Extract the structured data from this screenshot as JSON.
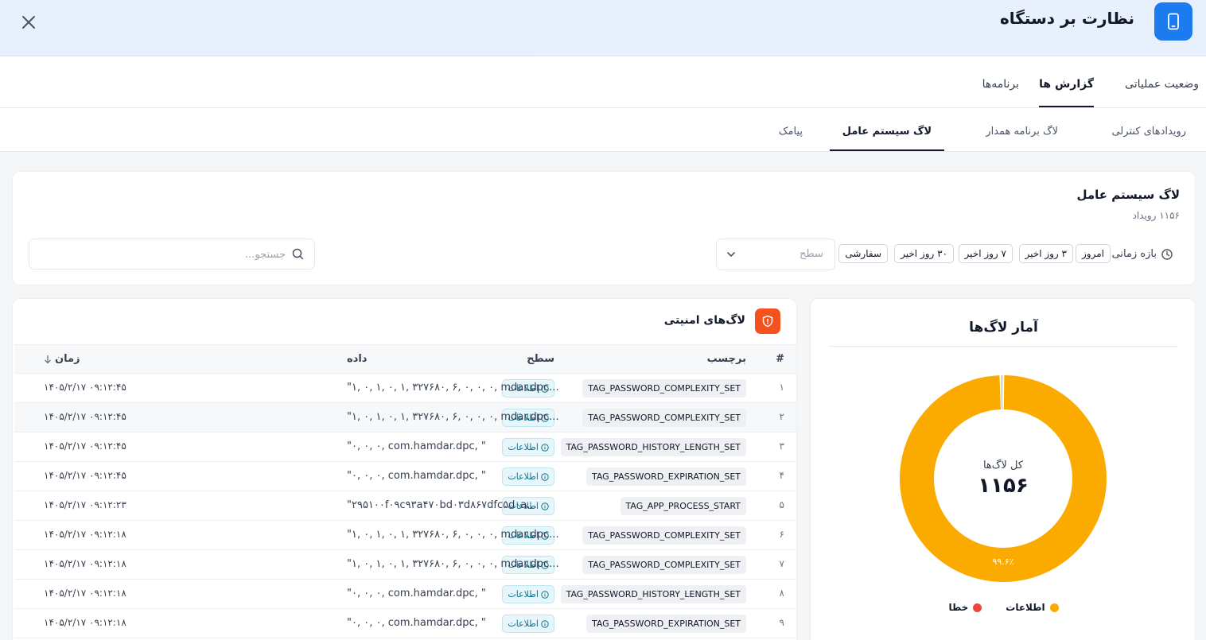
{
  "header": {
    "title": "نظارت بر دستگاه",
    "app_icon": "phone-icon",
    "close_icon": "close-icon"
  },
  "tabs": [
    {
      "label": "وضعیت عملیاتی",
      "active": false
    },
    {
      "label": "گزارش ها",
      "active": true
    },
    {
      "label": "برنامه‌ها",
      "active": false
    }
  ],
  "subtabs": [
    {
      "label": "رویدادهای کنترلی",
      "active": false
    },
    {
      "label": "لاگ برنامه همدار",
      "active": false
    },
    {
      "label": "لاگ سیستم عامل",
      "active": true
    },
    {
      "label": "پیامک",
      "active": false
    }
  ],
  "filters": {
    "title": "لاگ سیستم عامل",
    "count_text": "۱۱۵۶ رویداد",
    "range_label": "بازه زمانی:",
    "chips": [
      "امروز",
      "۳ روز اخیر",
      "۷ روز اخیر",
      "۳۰ روز اخیر",
      "سفارشی"
    ],
    "level_placeholder": "سطح",
    "search_placeholder": "جستجو..."
  },
  "table": {
    "title": "لاگ‌های امنیتی",
    "columns": {
      "num": "#",
      "tag": "برچسب",
      "level": "سطح",
      "data": "داده",
      "time": "زمان"
    },
    "rows": [
      {
        "num": "۱",
        "tag": "TAG_PASSWORD_COMPLEXITY_SET",
        "level": "اطلاعات",
        "data": "\"۱, ۰, ۱, ۰, ۱, ۳۲۷۶۸۰, ۶, ۰, ۰, ۰, mdar.dpc...",
        "time": "۱۴۰۵/۲/۱۷ ۰۹:۱۲:۴۵"
      },
      {
        "num": "۲",
        "tag": "TAG_PASSWORD_COMPLEXITY_SET",
        "level": "اطلاعات",
        "data": "\"۱, ۰, ۱, ۰, ۱, ۳۲۷۶۸۰, ۶, ۰, ۰, ۰, mdar.dpc...",
        "time": "۱۴۰۵/۲/۱۷ ۰۹:۱۲:۴۵"
      },
      {
        "num": "۳",
        "tag": "TAG_PASSWORD_HISTORY_LENGTH_SET",
        "level": "اطلاعات",
        "data": "\"۰, ۰, ۰, com.hamdar.dpc, \"",
        "time": "۱۴۰۵/۲/۱۷ ۰۹:۱۲:۴۵"
      },
      {
        "num": "۴",
        "tag": "TAG_PASSWORD_EXPIRATION_SET",
        "level": "اطلاعات",
        "data": "\"۰, ۰, ۰, com.hamdar.dpc, \"",
        "time": "۱۴۰۵/۲/۱۷ ۰۹:۱۲:۴۵"
      },
      {
        "num": "۵",
        "tag": "TAG_APP_PROCESS_START",
        "level": "اطلاعات",
        "data": "\"۲۹۵۱۰۰f۰۹c۹۳a۴۷۰bd۰۳d۸۶۷dfc۵d۰a...",
        "time": "۱۴۰۵/۲/۱۷ ۰۹:۱۲:۲۳"
      },
      {
        "num": "۶",
        "tag": "TAG_PASSWORD_COMPLEXITY_SET",
        "level": "اطلاعات",
        "data": "\"۱, ۰, ۱, ۰, ۱, ۳۲۷۶۸۰, ۶, ۰, ۰, ۰, mdar.dpc...",
        "time": "۱۴۰۵/۲/۱۷ ۰۹:۱۲:۱۸"
      },
      {
        "num": "۷",
        "tag": "TAG_PASSWORD_COMPLEXITY_SET",
        "level": "اطلاعات",
        "data": "\"۱, ۰, ۱, ۰, ۱, ۳۲۷۶۸۰, ۶, ۰, ۰, ۰, mdar.dpc...",
        "time": "۱۴۰۵/۲/۱۷ ۰۹:۱۲:۱۸"
      },
      {
        "num": "۸",
        "tag": "TAG_PASSWORD_HISTORY_LENGTH_SET",
        "level": "اطلاعات",
        "data": "\"۰, ۰, ۰, com.hamdar.dpc, \"",
        "time": "۱۴۰۵/۲/۱۷ ۰۹:۱۲:۱۸"
      },
      {
        "num": "۹",
        "tag": "TAG_PASSWORD_EXPIRATION_SET",
        "level": "اطلاعات",
        "data": "\"۰, ۰, ۰, com.hamdar.dpc, \"",
        "time": "۱۴۰۵/۲/۱۷ ۰۹:۱۲:۱۸"
      }
    ]
  },
  "stats": {
    "title": "آمار لاگ‌ها",
    "center_label": "کل لاگ‌ها",
    "center_value": "۱۱۵۶",
    "slice_label": "۹۹.۶٪",
    "legend": [
      {
        "label": "اطلاعات",
        "color": "#fbab00"
      },
      {
        "label": "خطا",
        "color": "#f44336"
      }
    ]
  },
  "chart_data": {
    "type": "pie",
    "categories": [
      "اطلاعات",
      "خطا"
    ],
    "values": [
      99.6,
      0.4
    ],
    "title": "آمار لاگ‌ها",
    "colors": [
      "#fbab00",
      "#f44336"
    ]
  },
  "colors": {
    "accent": "#1d7bf0",
    "security_icon": "#f4511e",
    "info_badge": "#0e7490"
  }
}
